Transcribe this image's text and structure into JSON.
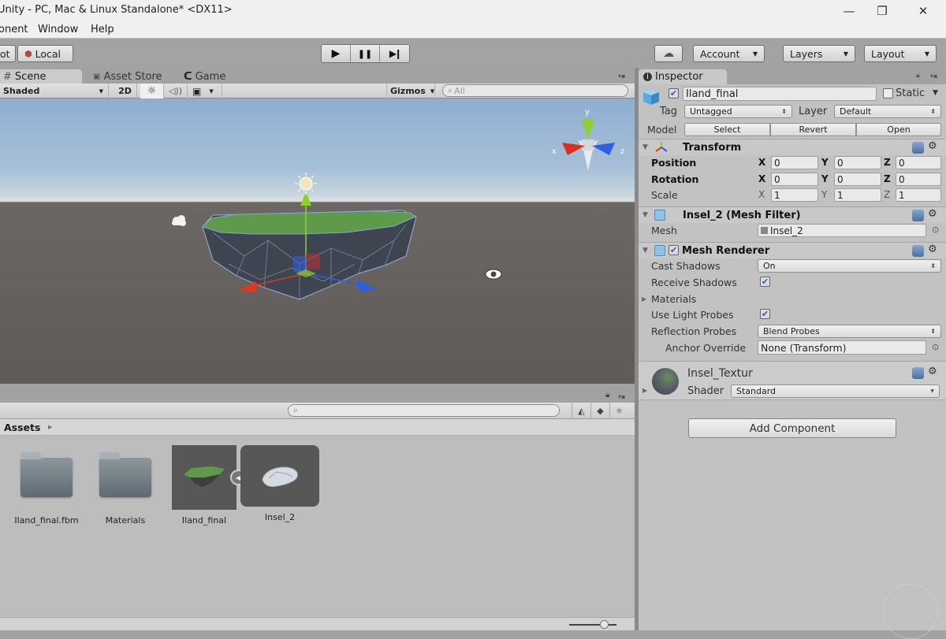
{
  "window": {
    "title": "Unity - PC, Mac & Linux Standalone* <DX11>",
    "controls": {
      "minimize": "—",
      "maximize": "❐",
      "close": "✕"
    }
  },
  "menu": {
    "items": [
      "Component",
      "Window",
      "Help"
    ],
    "visible_items": [
      "onent",
      "Window",
      "Help"
    ]
  },
  "toolbar": {
    "pivot_label": "ot",
    "local_label": "Local",
    "play_icon": "▶",
    "pause_icon": "❚❚",
    "step_icon": "▶❙",
    "cloud_icon": "☁",
    "account_label": "Account",
    "layers_label": "Layers",
    "layout_label": "Layout"
  },
  "scene": {
    "tabs": [
      {
        "label": "Scene",
        "icon": "#",
        "active": true
      },
      {
        "label": "Asset Store",
        "icon": "🛍",
        "active": false
      },
      {
        "label": "Game",
        "icon": "◐",
        "active": false
      }
    ],
    "shading_mode": "Shaded",
    "mode_2d": "2D",
    "lighting_icon": "☼",
    "audio_icon": "🔊",
    "effects_icon": "▣",
    "gizmos_label": "Gizmos",
    "search_placeholder": "All",
    "gizmo_axes": {
      "y": "y",
      "x": "x",
      "z": "z"
    }
  },
  "project": {
    "search_placeholder": "",
    "breadcrumb": "Assets",
    "assets": [
      {
        "name": "Iland_final.fbm",
        "type": "folder"
      },
      {
        "name": "Materials",
        "type": "folder"
      },
      {
        "name": "Iland_final",
        "type": "model",
        "selected": true
      },
      {
        "name": "Insel_2",
        "type": "mesh"
      }
    ],
    "thumbnail_size": 0.65
  },
  "inspector": {
    "tab_label": "Inspector",
    "object_name": "Iland_final",
    "active": true,
    "static_label": "Static",
    "static": false,
    "tag_label": "Tag",
    "tag_value": "Untagged",
    "layer_label": "Layer",
    "layer_value": "Default",
    "model_label": "Model",
    "model_buttons": [
      "Select",
      "Revert",
      "Open"
    ],
    "transform": {
      "title": "Transform",
      "rows": [
        {
          "label": "Position",
          "x": "0",
          "y": "0",
          "z": "0"
        },
        {
          "label": "Rotation",
          "x": "0",
          "y": "0",
          "z": "0"
        },
        {
          "label": "Scale",
          "x": "1",
          "y": "1",
          "z": "1"
        }
      ]
    },
    "mesh_filter": {
      "title": "Insel_2 (Mesh Filter)",
      "mesh_label": "Mesh",
      "mesh_value": "Insel_2"
    },
    "mesh_renderer": {
      "title": "Mesh Renderer",
      "enabled": true,
      "cast_shadows_label": "Cast Shadows",
      "cast_shadows_value": "On",
      "receive_shadows_label": "Receive Shadows",
      "receive_shadows": true,
      "materials_label": "Materials",
      "use_light_probes_label": "Use Light Probes",
      "use_light_probes": true,
      "reflection_probes_label": "Reflection Probes",
      "reflection_probes_value": "Blend Probes",
      "anchor_override_label": "Anchor Override",
      "anchor_override_value": "None (Transform)"
    },
    "material": {
      "name": "Insel_Textur",
      "shader_label": "Shader",
      "shader_value": "Standard"
    },
    "add_component_label": "Add Component"
  },
  "icons": {
    "checkmark": "✔",
    "gear": "⚙",
    "fold_open": "▼",
    "fold_closed": "▶",
    "updown": "⇕",
    "caret_down": "▼",
    "target": "⊙",
    "lock": "🔒",
    "star": "★",
    "tag": "🏷",
    "eye": "👁"
  },
  "colors": {
    "sky_top": "#8eaed0",
    "ground": "#605c5a",
    "grass": "#5e9a4a",
    "axis_x": "#e0391c",
    "axis_y": "#8ed12b",
    "axis_z": "#2d5fe0"
  }
}
